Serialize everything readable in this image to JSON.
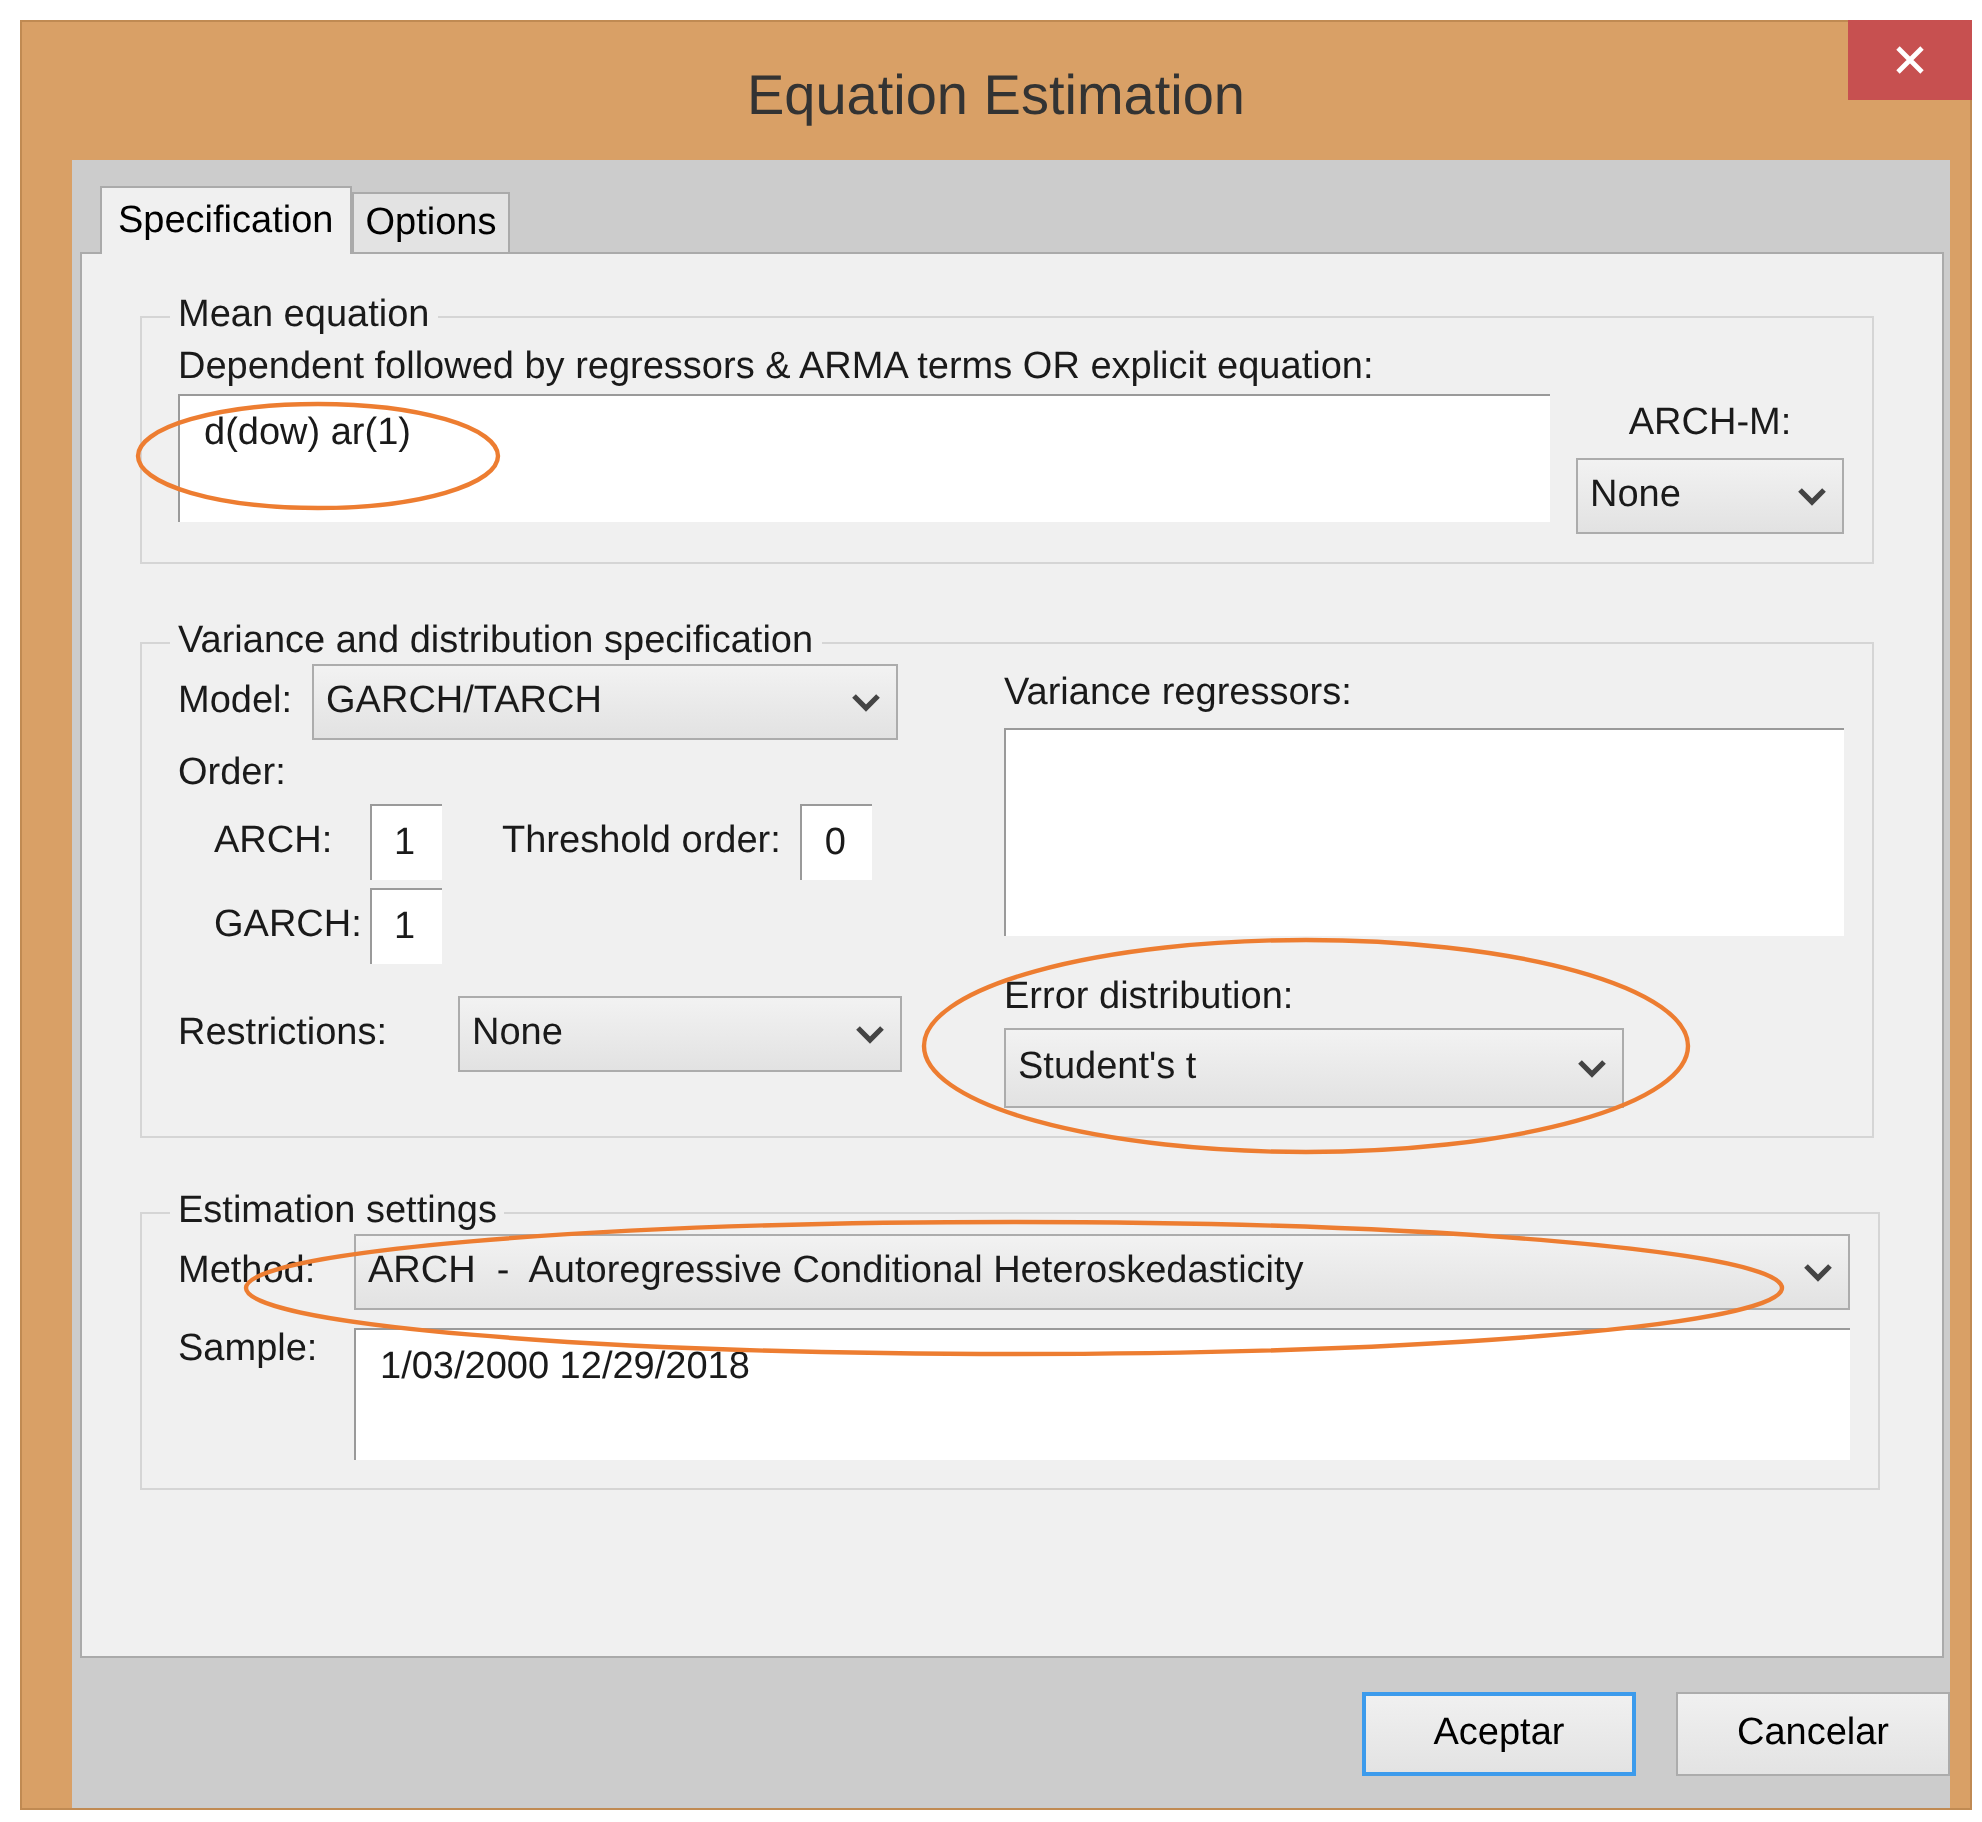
{
  "window": {
    "title": "Equation Estimation"
  },
  "tabs": [
    {
      "label": "Specification",
      "selected": true
    },
    {
      "label": "Options",
      "selected": false
    }
  ],
  "mean_equation": {
    "title": "Mean equation",
    "prompt": "Dependent followed by regressors & ARMA terms OR explicit equation:",
    "value": "d(dow) ar(1)",
    "circled": true,
    "arch_m_label": "ARCH-M:",
    "arch_m": "None"
  },
  "variance": {
    "title": "Variance and distribution specification",
    "model_label": "Model:",
    "model": "GARCH/TARCH",
    "order_label": "Order:",
    "arch_label": "ARCH:",
    "arch": "1",
    "threshold_label": "Threshold order:",
    "threshold": "0",
    "garch_label": "GARCH:",
    "garch": "1",
    "restrictions_label": "Restrictions:",
    "restrictions": "None",
    "regressors_label": "Variance regressors:",
    "error_label": "Error distribution:",
    "error": "Student's t",
    "error_circled": true
  },
  "estimation": {
    "title": "Estimation settings",
    "method_label": "Method:",
    "method": "ARCH  -  Autoregressive Conditional Heteroskedasticity",
    "method_circled": true,
    "sample_label": "Sample:",
    "sample": "1/03/2000 12/29/2018"
  },
  "buttons": [
    {
      "label": "Aceptar",
      "default": true
    },
    {
      "label": "Cancelar",
      "default": false
    }
  ]
}
